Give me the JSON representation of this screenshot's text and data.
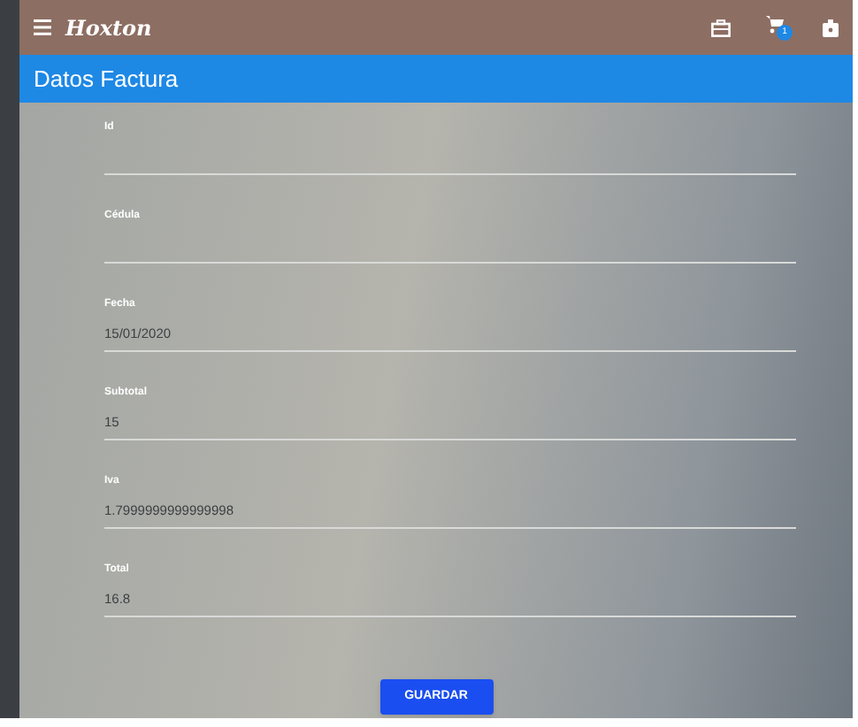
{
  "app_bar": {
    "title": "Hoxton",
    "cart_badge": "1"
  },
  "header": {
    "title": "Datos Factura"
  },
  "fields": [
    {
      "label": "Id"
    },
    {
      "label": "Cédula"
    },
    {
      "label": "Fecha",
      "value": "15/01/2020"
    },
    {
      "label": "Subtotal",
      "value": "15"
    },
    {
      "label": "Iva",
      "value": "1.7999999999999998"
    },
    {
      "label": "Total",
      "value": "16.8"
    }
  ],
  "button": "GUARDAR"
}
